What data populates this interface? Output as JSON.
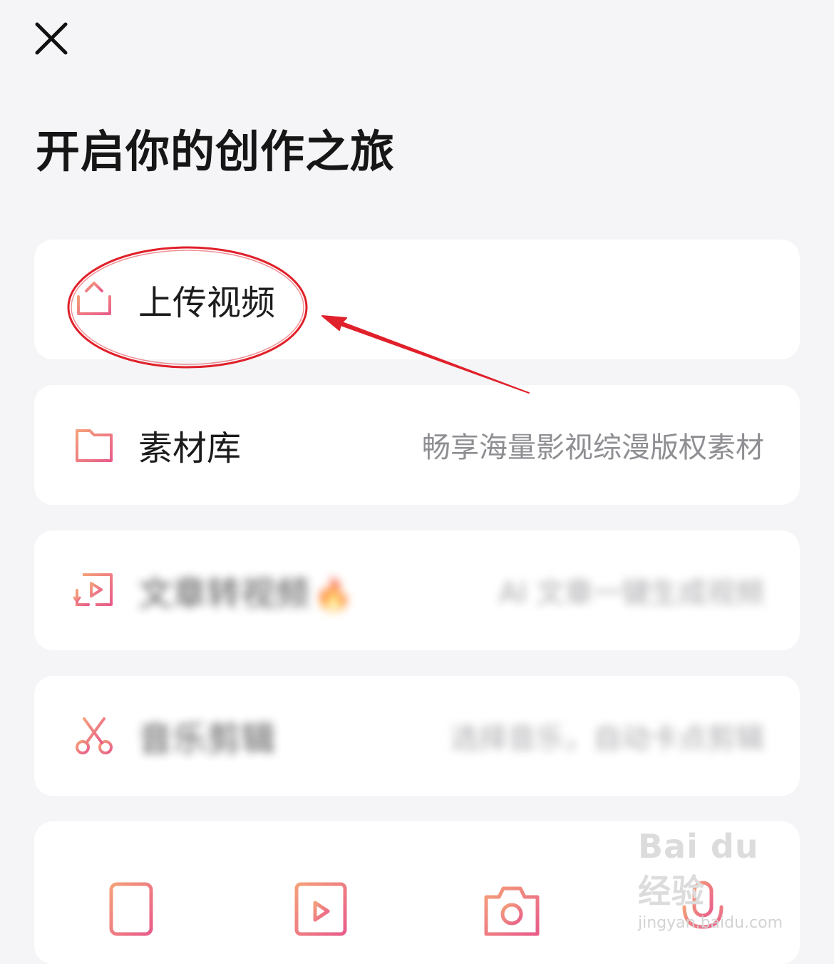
{
  "header": {
    "close_icon": "close-icon",
    "title": "开启你的创作之旅"
  },
  "menu": [
    {
      "icon": "upload-icon",
      "label": "上传视频",
      "description": ""
    },
    {
      "icon": "folder-list-icon",
      "label": "素材库",
      "description": "畅享海量影视综漫版权素材"
    },
    {
      "icon": "article-to-video-icon",
      "label": "文章转视频",
      "badge": "🔥",
      "description": "AI 文章一键生成视频"
    },
    {
      "icon": "scissors-icon",
      "label": "音乐剪辑",
      "description": "选择音乐，自动卡点剪辑"
    }
  ],
  "tools": [
    {
      "icon": "document-icon"
    },
    {
      "icon": "video-play-icon"
    },
    {
      "icon": "camera-icon"
    },
    {
      "icon": "microphone-icon"
    }
  ],
  "watermark": {
    "logo": "Bai du 经验",
    "url": "jingyan.baidu.com"
  },
  "colors": {
    "accent_start": "#f4a07a",
    "accent_end": "#e85d8a",
    "annotation_red": "#e0202a"
  }
}
